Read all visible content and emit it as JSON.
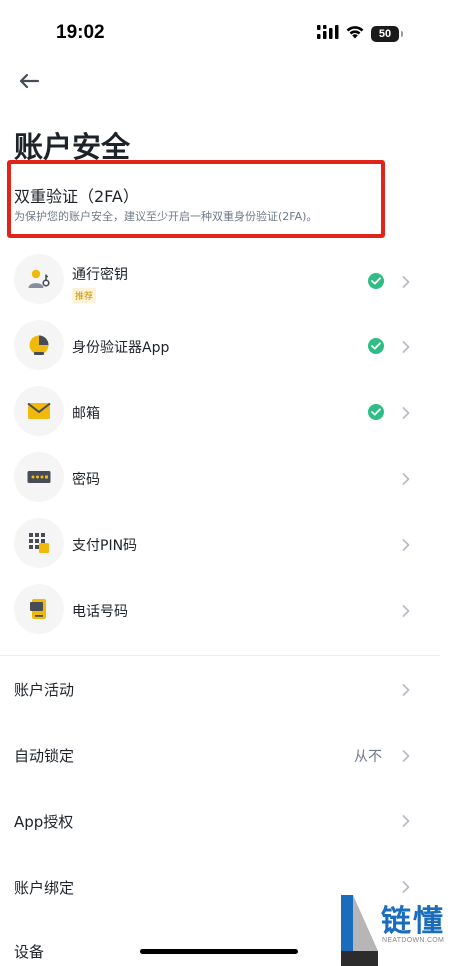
{
  "status_bar": {
    "time": "19:02",
    "battery": "50",
    "icons": [
      "cellular-signal-icon",
      "wifi-icon",
      "battery-icon"
    ]
  },
  "header": {
    "back_icon": "back-arrow-icon",
    "title": "账户安全"
  },
  "two_factor": {
    "title": "双重验证（2FA）",
    "description": "为保护您的账户安全，建议至少开启一种双重身份验证(2FA)。",
    "highlight_color": "#e2231a",
    "methods": [
      {
        "label": "通行密钥",
        "tag": "推荐",
        "icon": "passkey-icon",
        "enabled": true
      },
      {
        "label": "身份验证器App",
        "tag": "",
        "icon": "authenticator-icon",
        "enabled": true
      },
      {
        "label": "邮箱",
        "tag": "",
        "icon": "email-icon",
        "enabled": true
      },
      {
        "label": "密码",
        "tag": "",
        "icon": "password-icon",
        "enabled": false
      },
      {
        "label": "支付PIN码",
        "tag": "",
        "icon": "pin-icon",
        "enabled": false
      },
      {
        "label": "电话号码",
        "tag": "",
        "icon": "phone-icon",
        "enabled": false
      }
    ]
  },
  "settings": {
    "rows": [
      {
        "label": "账户活动",
        "value": ""
      },
      {
        "label": "自动锁定",
        "value": "从不"
      },
      {
        "label": "App授权",
        "value": ""
      },
      {
        "label": "账户绑定",
        "value": ""
      },
      {
        "label": "设备",
        "value": ""
      }
    ]
  },
  "watermark": {
    "text": "链懂",
    "sub": "NEATDOWN.COM"
  },
  "colors": {
    "accent": "#fcd535",
    "success": "#2ebd85",
    "text_primary": "#1e2329",
    "text_secondary": "#707a8a"
  }
}
